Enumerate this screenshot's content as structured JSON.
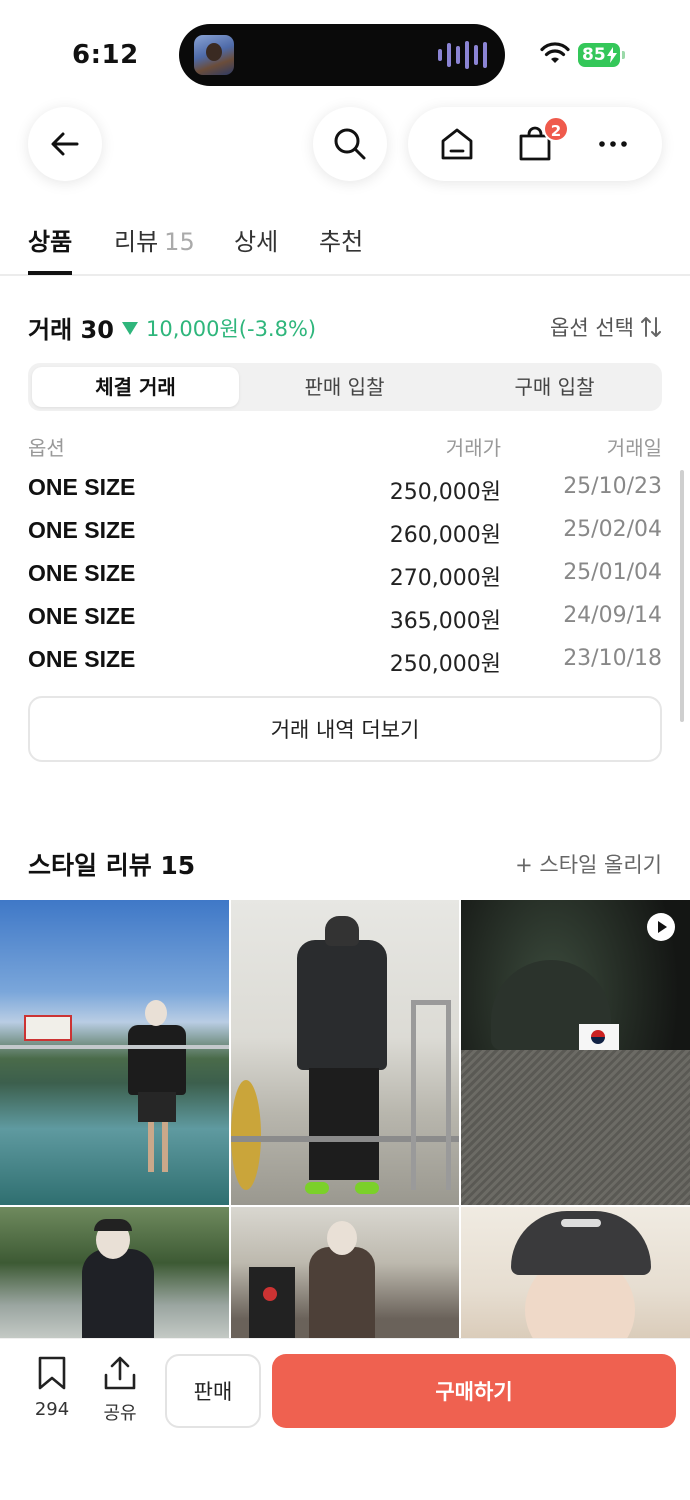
{
  "status_bar": {
    "time": "6:12",
    "battery": "85"
  },
  "nav": {
    "cart_badge": "2"
  },
  "tabs": [
    {
      "label": "상품"
    },
    {
      "label": "리뷰",
      "count": "15"
    },
    {
      "label": "상세"
    },
    {
      "label": "추천"
    }
  ],
  "trade": {
    "title": "거래 30",
    "change": "10,000원(-3.8%)",
    "option_select": "옵션 선택",
    "segments": [
      "체결 거래",
      "판매 입찰",
      "구매 입찰"
    ],
    "headers": {
      "option": "옵션",
      "price": "거래가",
      "date": "거래일"
    },
    "rows": [
      {
        "option": "ONE SIZE",
        "price": "250,000원",
        "date": "25/10/23"
      },
      {
        "option": "ONE SIZE",
        "price": "260,000원",
        "date": "25/02/04"
      },
      {
        "option": "ONE SIZE",
        "price": "270,000원",
        "date": "25/01/04"
      },
      {
        "option": "ONE SIZE",
        "price": "365,000원",
        "date": "24/09/14"
      },
      {
        "option": "ONE SIZE",
        "price": "250,000원",
        "date": "23/10/18"
      }
    ],
    "more_label": "거래 내역 더보기"
  },
  "style_review": {
    "title": "스타일 리뷰 15",
    "upload_label": "+ 스타일 올리기"
  },
  "bottom": {
    "bookmark_count": "294",
    "share_label": "공유",
    "sell_label": "판매",
    "buy_label": "구매하기"
  },
  "colors": {
    "accent": "#ef6150",
    "price_down": "#2fb67c",
    "badge": "#ef5a4c"
  }
}
